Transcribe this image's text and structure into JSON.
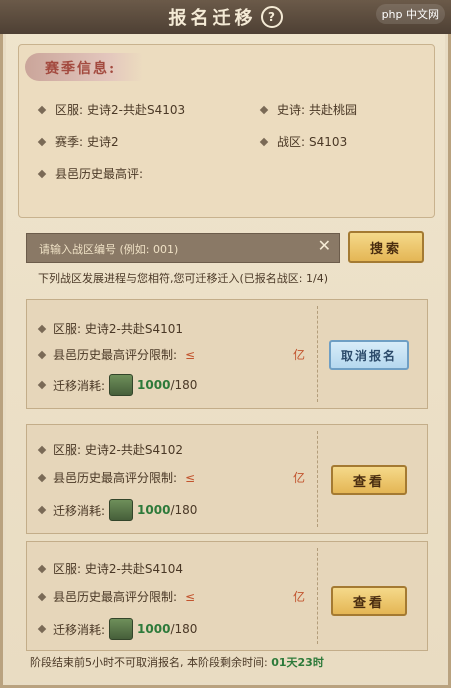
{
  "header": {
    "title": "报名迁移",
    "watermark": "php 中文网"
  },
  "season_info": {
    "ribbon": "赛季信息:",
    "server_label": "区服:",
    "server_value": "史诗2-共赴S4103",
    "epic_label": "史诗:",
    "epic_value": "共赴桃园",
    "season_label": "赛季:",
    "season_value": "史诗2",
    "zone_label": "战区:",
    "zone_value": "S4103",
    "county_label": "县邑历史最高评:"
  },
  "search": {
    "placeholder": "请输入战区编号 (例如: 001)",
    "button": "搜索"
  },
  "hint": "下列战区发展进程与您相符,您可迁移迁入(已报名战区: 1/4)",
  "cards": [
    {
      "server": "区服: 史诗2-共赴S4101",
      "limit": "县邑历史最高评分限制:",
      "le": "≤",
      "unit": "亿",
      "cost_label": "迁移消耗:",
      "cost_current": "1000",
      "cost_total": "/180",
      "button": "取消报名"
    },
    {
      "server": "区服: 史诗2-共赴S4102",
      "limit": "县邑历史最高评分限制:",
      "le": "≤",
      "unit": "亿",
      "cost_label": "迁移消耗:",
      "cost_current": "1000",
      "cost_total": "/180",
      "button": "查看"
    },
    {
      "server": "区服: 史诗2-共赴S4104",
      "limit": "县邑历史最高评分限制:",
      "le": "≤",
      "unit": "亿",
      "cost_label": "迁移消耗:",
      "cost_current": "1000",
      "cost_total": "/180",
      "button": "查看"
    }
  ],
  "footer": {
    "text": "阶段结束前5小时不可取消报名, 本阶段剩余时间:",
    "time": "01天23时"
  },
  "colors": {
    "gold_button": "#e4b655",
    "blue_button": "#b5d8ef",
    "accent_red": "#c2542e",
    "accent_green": "#2d7a3a"
  }
}
